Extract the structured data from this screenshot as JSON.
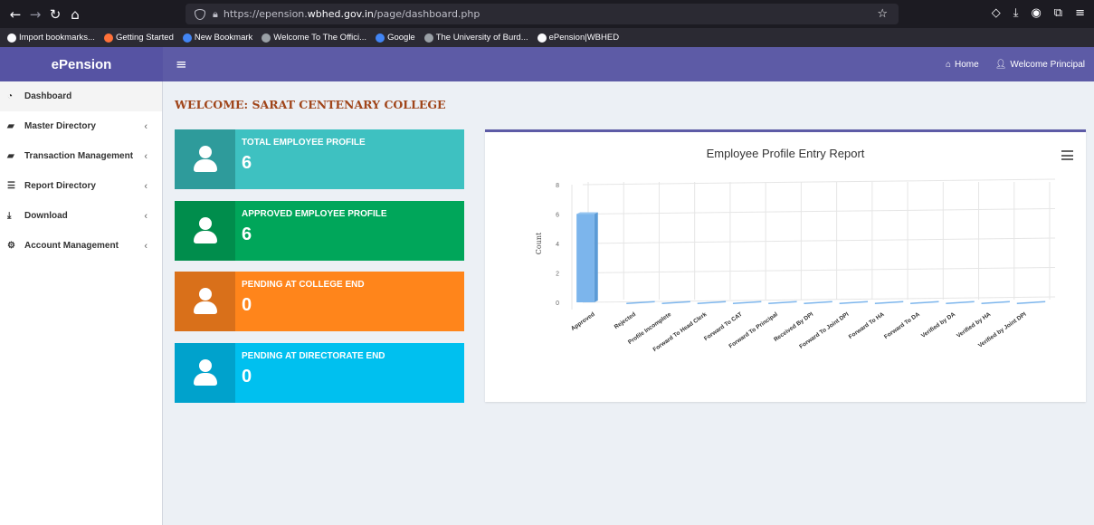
{
  "browser": {
    "url_prefix": "https://epension.",
    "url_domain": "wbhed.gov.in",
    "url_suffix": "/page/dashboard.php",
    "bookmarks": [
      {
        "label": "Import bookmarks...",
        "color": "#fbfbfe"
      },
      {
        "label": "Getting Started",
        "color": "#ff7139"
      },
      {
        "label": "New Bookmark",
        "color": "#4285f4"
      },
      {
        "label": "Welcome To The Offici...",
        "color": "#9aa0a6"
      },
      {
        "label": "Google",
        "color": "#4285f4"
      },
      {
        "label": "The University of Burd...",
        "color": "#9aa0a6"
      },
      {
        "label": "ePension|WBHED",
        "color": "#fbfbfe"
      }
    ]
  },
  "header": {
    "brand": "ePension",
    "home_label": "Home",
    "welcome_user": "Welcome Principal"
  },
  "sidebar": {
    "items": [
      {
        "label": "Dashboard",
        "icon": "dashboard-icon",
        "has_chevron": false
      },
      {
        "label": "Master Directory",
        "icon": "book-icon",
        "has_chevron": true
      },
      {
        "label": "Transaction Management",
        "icon": "book-icon",
        "has_chevron": true
      },
      {
        "label": "Report Directory",
        "icon": "database-icon",
        "has_chevron": true
      },
      {
        "label": "Download",
        "icon": "download-icon",
        "has_chevron": true
      },
      {
        "label": "Account Management",
        "icon": "cogs-icon",
        "has_chevron": true
      }
    ]
  },
  "main": {
    "welcome": "WELCOME: SARAT CENTENARY COLLEGE",
    "cards": [
      {
        "label": "TOTAL EMPLOYEE PROFILE",
        "value": "6",
        "color": "#3ec1c1",
        "icon_color": "#2e9b9b"
      },
      {
        "label": "APPROVED EMPLOYEE PROFILE",
        "value": "6",
        "color": "#00a65a",
        "icon_color": "#008d4c"
      },
      {
        "label": "PENDING AT COLLEGE END",
        "value": "0",
        "color": "#ff851b",
        "icon_color": "#d9701a"
      },
      {
        "label": "PENDING AT DIRECTORATE END",
        "value": "0",
        "color": "#00c0ef",
        "icon_color": "#00a2cc"
      }
    ]
  },
  "chart_data": {
    "type": "bar",
    "title": "Employee Profile Entry Report",
    "ylabel": "Count",
    "xlabel": "",
    "ylim": [
      0,
      8
    ],
    "yticks": [
      0,
      2,
      4,
      6,
      8
    ],
    "categories": [
      "Approved",
      "Rejected",
      "Profile Incomplete",
      "Forward To Head Clerk",
      "Forward To CAT",
      "Forward To Principal",
      "Received By DPI",
      "Forward To Joint DPI",
      "Forward To HA",
      "Forward To DA",
      "Verified by DA",
      "Verified by HA",
      "Verified by Joint DPI"
    ],
    "values": [
      6,
      0,
      0,
      0,
      0,
      0,
      0,
      0,
      0,
      0,
      0,
      0,
      0
    ],
    "bar_color": "#7cb5ec",
    "grid": true
  }
}
